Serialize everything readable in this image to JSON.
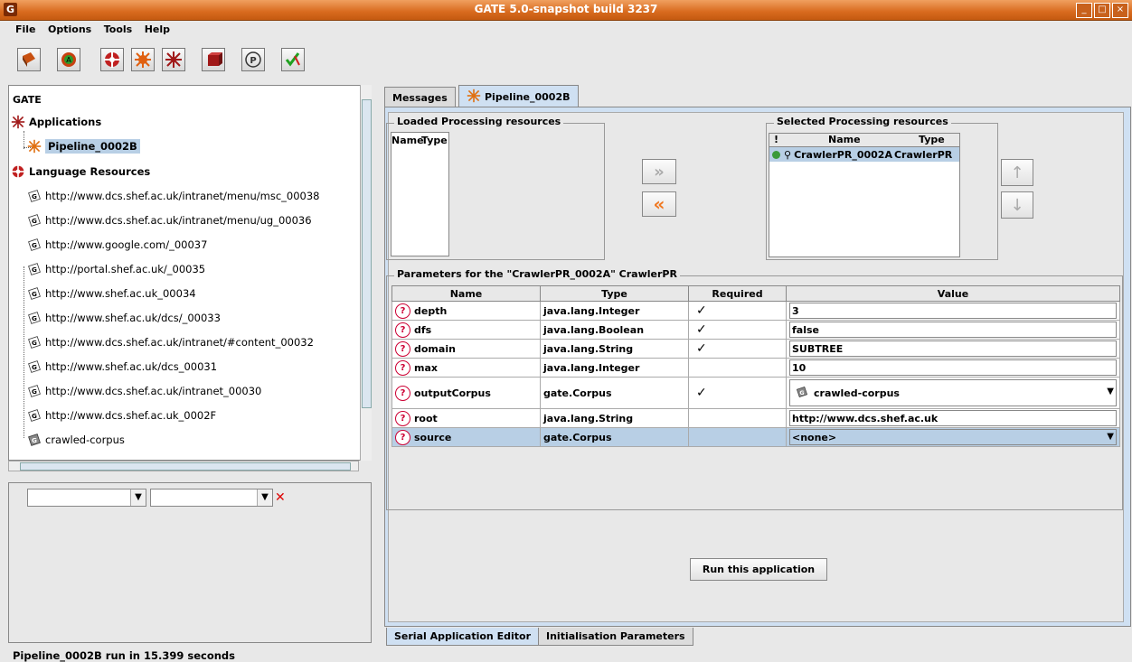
{
  "window": {
    "title": "GATE 5.0-snapshot build 3237",
    "app_icon_letter": "G"
  },
  "menubar": {
    "items": [
      "File",
      "Options",
      "Tools",
      "Help"
    ]
  },
  "toolbar": {
    "buttons": [
      "load-resource-icon",
      "annie-icon",
      "language-resource-icon",
      "processing-resource-icon",
      "application-icon",
      "datastore-icon",
      "plugin-manager-icon",
      "jape-debugger-icon"
    ]
  },
  "tree": {
    "root": "GATE",
    "applications_label": "Applications",
    "application_item": "Pipeline_0002B",
    "language_resources_label": "Language Resources",
    "language_resources": [
      "http://www.dcs.shef.ac.uk/intranet/menu/msc_00038",
      "http://www.dcs.shef.ac.uk/intranet/menu/ug_00036",
      "http://www.google.com/_00037",
      "http://portal.shef.ac.uk/_00035",
      "http://www.shef.ac.uk_00034",
      "http://www.shef.ac.uk/dcs/_00033",
      "http://www.dcs.shef.ac.uk/intranet/#content_00032",
      "http://www.shef.ac.uk/dcs_00031",
      "http://www.dcs.shef.ac.uk/intranet_00030",
      "http://www.dcs.shef.ac.uk_0002F",
      "crawled-corpus"
    ]
  },
  "tabs": {
    "messages": "Messages",
    "pipeline": "Pipeline_0002B"
  },
  "loaded_pr": {
    "title": "Loaded Processing resources",
    "col_name": "Name",
    "col_type": "Type"
  },
  "selected_pr": {
    "title": "Selected Processing resources",
    "col_flag": "!",
    "col_name": "Name",
    "col_type": "Type",
    "row": {
      "name": "CrawlerPR_0002A",
      "type": "CrawlerPR"
    }
  },
  "params": {
    "title": "Parameters for the \"CrawlerPR_0002A\" CrawlerPR",
    "headers": {
      "name": "Name",
      "type": "Type",
      "required": "Required",
      "value": "Value"
    },
    "check": "✓",
    "rows": [
      {
        "name": "depth",
        "type": "java.lang.Integer",
        "value": "3"
      },
      {
        "name": "dfs",
        "type": "java.lang.Boolean",
        "value": "false"
      },
      {
        "name": "domain",
        "type": "java.lang.String",
        "value": "SUBTREE"
      },
      {
        "name": "max",
        "type": "java.lang.Integer",
        "value": "10"
      },
      {
        "name": "outputCorpus",
        "type": "gate.Corpus",
        "value": "crawled-corpus"
      },
      {
        "name": "root",
        "type": "java.lang.String",
        "value": "http://www.dcs.shef.ac.uk"
      },
      {
        "name": "source",
        "type": "gate.Corpus",
        "value": "<none>"
      }
    ]
  },
  "run_button": "Run this application",
  "bottom_tabs": {
    "editor": "Serial Application Editor",
    "init": "Initialisation Parameters"
  },
  "status": "Pipeline_0002B run in 15.399 seconds",
  "colors": {
    "titlebar": "#d86a1e",
    "selection": "#b8cfe5",
    "tab_active": "#cfe0f2",
    "arrow_orange": "#f07820"
  }
}
